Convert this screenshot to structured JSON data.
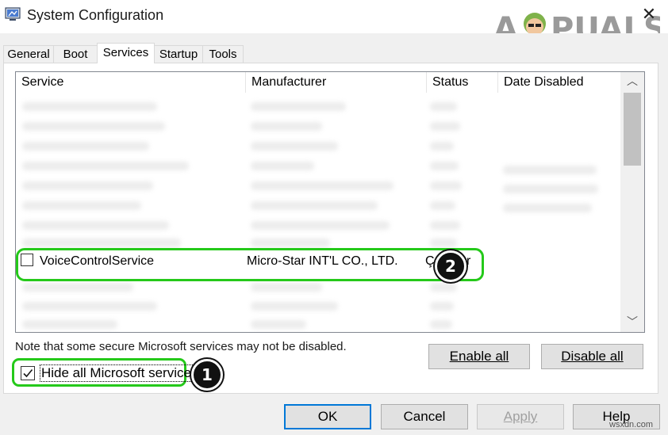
{
  "window": {
    "title": "System Configuration",
    "close_glyph": "✕"
  },
  "logo": {
    "text": "A PUALS"
  },
  "tabs": [
    {
      "label": "General",
      "active": false
    },
    {
      "label": "Boot",
      "active": false
    },
    {
      "label": "Services",
      "active": true
    },
    {
      "label": "Startup",
      "active": false
    },
    {
      "label": "Tools",
      "active": false
    }
  ],
  "services_list": {
    "columns": [
      "Service",
      "Manufacturer",
      "Status",
      "Date Disabled"
    ],
    "highlighted_row": {
      "service": "VoiceControlService",
      "manufacturer": "Micro-Star INT'L CO., LTD.",
      "status_visible": "Ç",
      "status_visible_end": "r",
      "checked": false
    },
    "scroll_up_glyph": "︿",
    "scroll_down_glyph": "﹀"
  },
  "note": "Note that some secure Microsoft services may not be disabled.",
  "buttons": {
    "enable_all": "Enable all",
    "disable_all": "Disable all",
    "ok": "OK",
    "cancel": "Cancel",
    "apply": "Apply",
    "help": "Help"
  },
  "hide_microsoft": {
    "label": "Hide all Microsoft services",
    "checked": true
  },
  "badges": {
    "one": "1",
    "two": "2"
  },
  "watermark": "wsxdn.com",
  "colors": {
    "highlight": "#25c91a",
    "accent": "#0078d7",
    "badge": "#111111"
  }
}
